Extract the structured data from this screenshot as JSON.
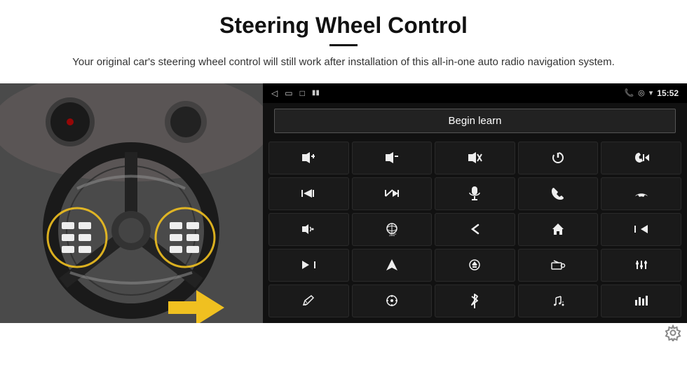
{
  "header": {
    "title": "Steering Wheel Control",
    "subtitle": "Your original car's steering wheel control will still work after installation of this all-in-one auto radio navigation system."
  },
  "status_bar": {
    "time": "15:52",
    "back_icon": "◁",
    "home_icon": "□",
    "recent_icon": "▭",
    "signal_icon": "▮▮",
    "phone_icon": "📞",
    "location_icon": "◎",
    "wifi_icon": "▾"
  },
  "begin_learn": {
    "label": "Begin learn"
  },
  "controls": [
    {
      "icon": "🔊+",
      "name": "vol-up"
    },
    {
      "icon": "🔊-",
      "name": "vol-down"
    },
    {
      "icon": "🔇",
      "name": "mute"
    },
    {
      "icon": "⏻",
      "name": "power"
    },
    {
      "icon": "⏮",
      "name": "prev-track"
    },
    {
      "icon": "⏭",
      "name": "next-track"
    },
    {
      "icon": "⏭✂",
      "name": "skip"
    },
    {
      "icon": "🎤",
      "name": "mic"
    },
    {
      "icon": "📞",
      "name": "call"
    },
    {
      "icon": "↩",
      "name": "hang-up"
    },
    {
      "icon": "📢",
      "name": "speaker"
    },
    {
      "icon": "⟳",
      "name": "360"
    },
    {
      "icon": "↺",
      "name": "back"
    },
    {
      "icon": "⌂",
      "name": "home"
    },
    {
      "icon": "⏮⏮",
      "name": "rew"
    },
    {
      "icon": "⏭⏭",
      "name": "ff"
    },
    {
      "icon": "➤",
      "name": "nav"
    },
    {
      "icon": "⊜",
      "name": "eject"
    },
    {
      "icon": "📻",
      "name": "radio"
    },
    {
      "icon": "⚙",
      "name": "eq"
    },
    {
      "icon": "✒",
      "name": "pen"
    },
    {
      "icon": "⊙",
      "name": "circle"
    },
    {
      "icon": "✱",
      "name": "bt"
    },
    {
      "icon": "♪⚙",
      "name": "music-set"
    },
    {
      "icon": "▐▌▌",
      "name": "spectrum"
    }
  ],
  "settings_icon": "⚙"
}
